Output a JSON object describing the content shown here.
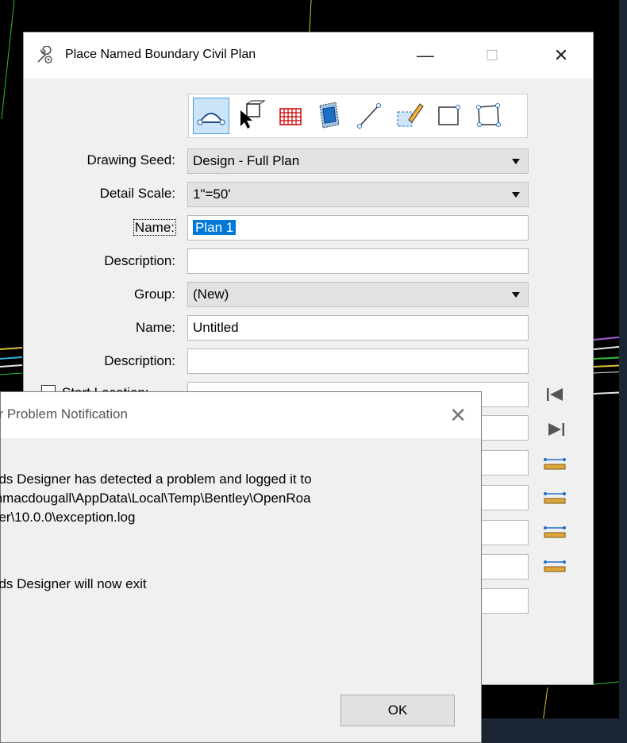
{
  "dialog": {
    "title": "Place Named Boundary Civil Plan",
    "minimize_glyph": "—",
    "maximize_glyph": "☐",
    "close_glyph": "✕"
  },
  "toolbar": {
    "tools": [
      "civil-plan-icon",
      "select-box-icon",
      "grid-table-icon",
      "view-volume-icon",
      "line-icon",
      "edit-shape-icon",
      "rectangle-icon",
      "polygon-icon"
    ]
  },
  "form": {
    "drawing_seed_label": "Drawing Seed:",
    "drawing_seed_value": "Design - Full Plan",
    "detail_scale_label": "Detail Scale:",
    "detail_scale_value": "1\"=50'",
    "name_label": "Name:",
    "name_value": "Plan 1",
    "description_label": "Description:",
    "description_value": "",
    "group_label": "Group:",
    "group_value": "(New)",
    "group_name_label": "Name:",
    "group_name_value": "Untitled",
    "group_description_label": "Description:",
    "group_description_value": "",
    "start_location_label": "Start Location:"
  },
  "error_dialog": {
    "title": "er Problem Notification",
    "close_glyph": "✕",
    "message_line1": "ads Designer has detected a problem and logged it to",
    "message_line2": "mmacdougall\\AppData\\Local\\Temp\\Bentley\\OpenRoa",
    "message_line3": "ner\\10.0.0\\exception.log",
    "message_exit": "ads Designer will now exit",
    "ok_label": "OK"
  },
  "colors": {
    "accent": "#0078d7",
    "dialog_bg": "#f0f0f0",
    "canvas_bg": "#000000"
  }
}
